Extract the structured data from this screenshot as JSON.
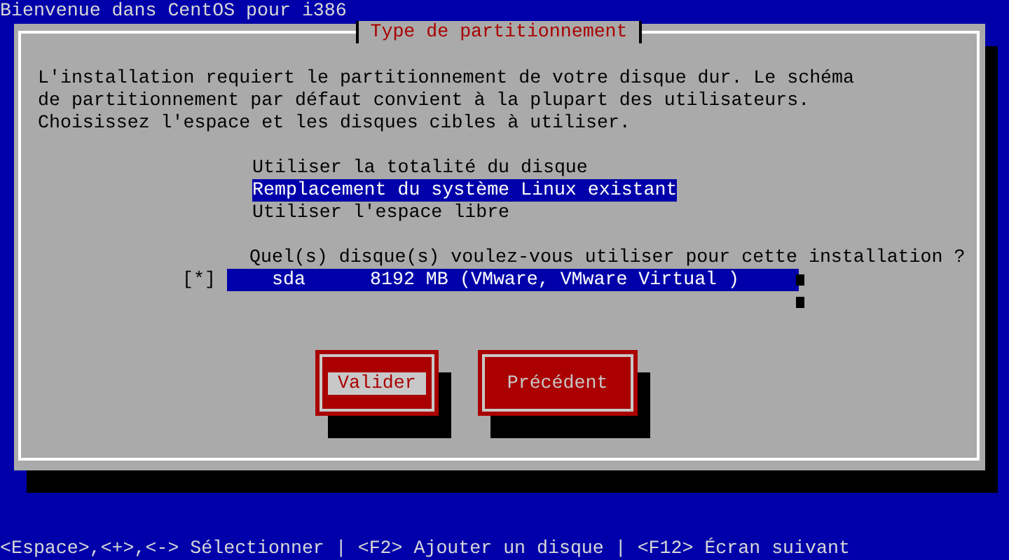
{
  "window": {
    "title": "Bienvenue dans CentOS pour i386"
  },
  "dialog": {
    "title": "Type de partitionnement",
    "message": "L'installation requiert le partitionnement de votre disque dur. Le schéma\nde partitionnement par défaut convient à la plupart des utilisateurs.\nChoisissez l'espace et les disques cibles à utiliser.",
    "options": [
      {
        "label": "Utiliser la totalité du disque",
        "selected": false
      },
      {
        "label": "Remplacement du système Linux existant",
        "selected": true
      },
      {
        "label": "Utiliser l'espace libre",
        "selected": false
      }
    ],
    "disk_prompt": "Quel(s) disque(s) voulez-vous utiliser pour cette installation ?",
    "disks": [
      {
        "checkbox": "[*]",
        "checked": true,
        "name": "sda",
        "size": "8192 MB",
        "model": "(VMware, VMware Virtual )",
        "selected": true
      }
    ],
    "buttons": [
      {
        "label": "Valider",
        "focused": true
      },
      {
        "label": "Précédent",
        "focused": false
      }
    ]
  },
  "status_bar": "<Espace>,<+>,<-> Sélectionner | <F2> Ajouter un disque | <F12> Écran suivant"
}
